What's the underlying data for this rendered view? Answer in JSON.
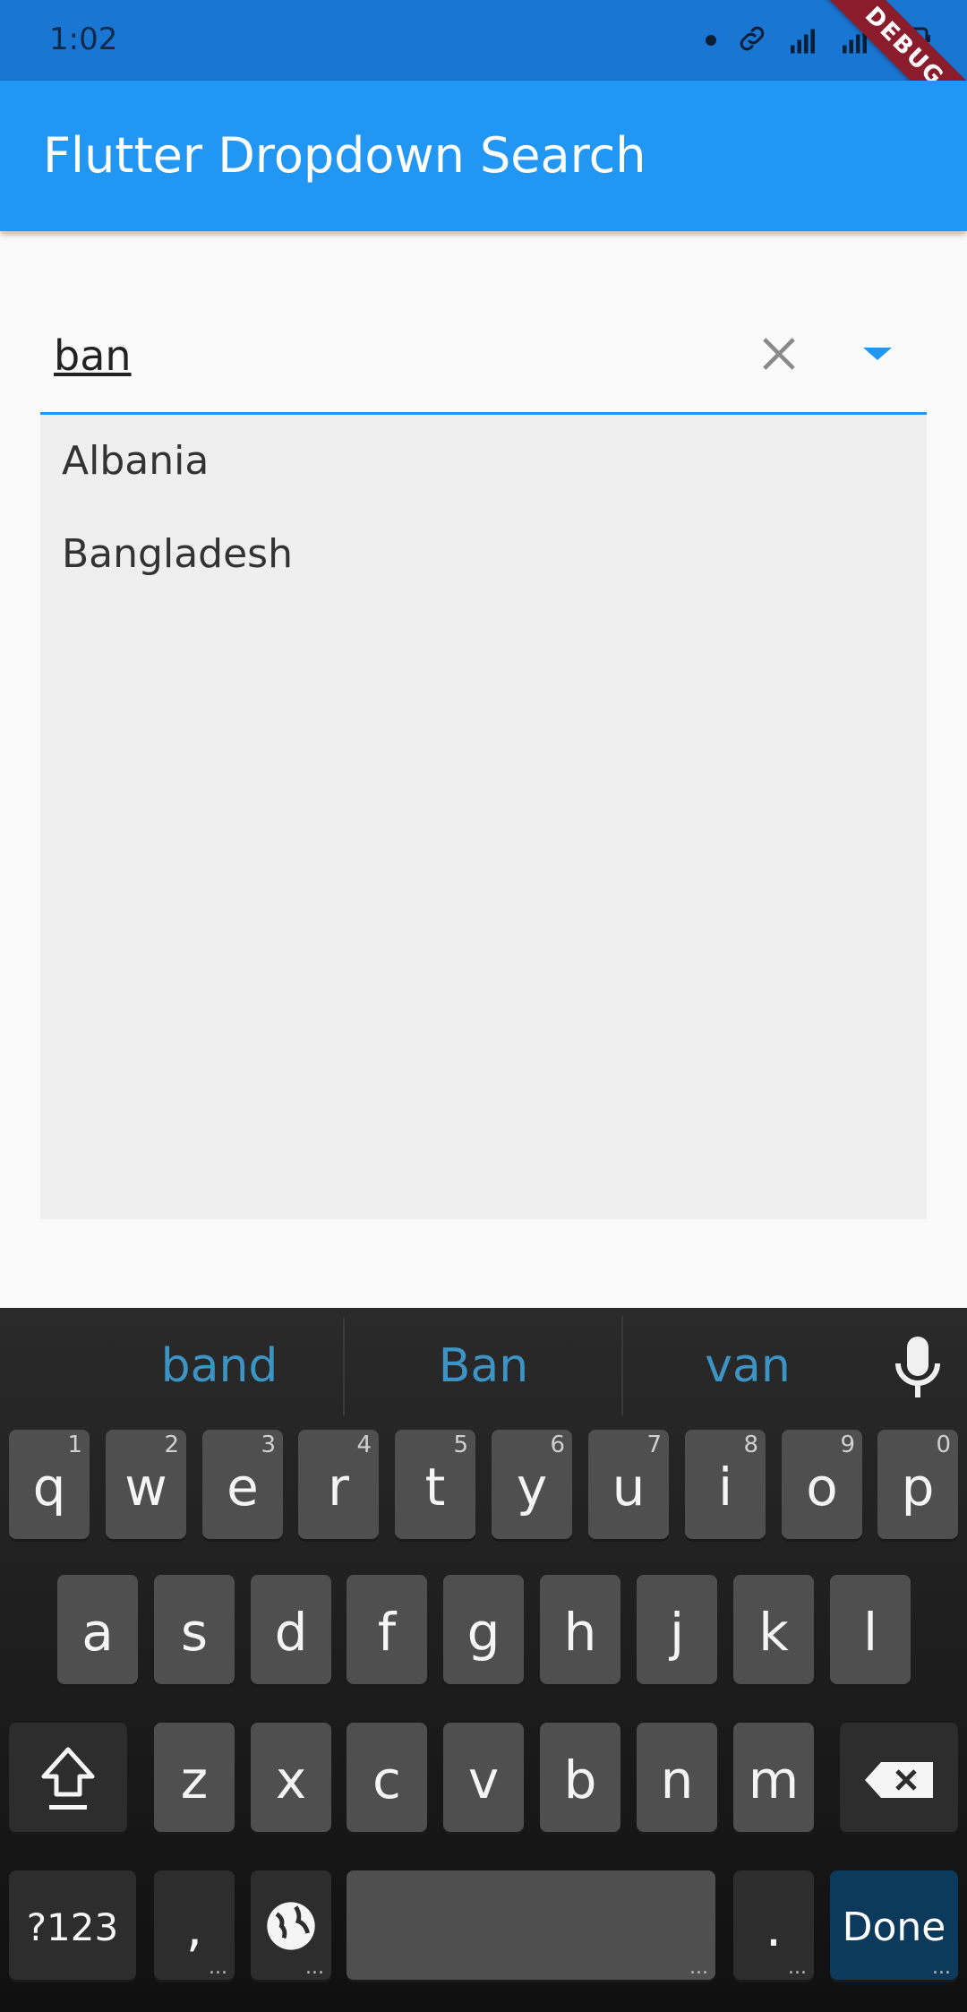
{
  "status_bar": {
    "time": "1:02",
    "debug_label": "DEBUG"
  },
  "app_bar": {
    "title": "Flutter Dropdown Search"
  },
  "search": {
    "value": "ban"
  },
  "results": [
    {
      "label": "Albania"
    },
    {
      "label": "Bangladesh"
    }
  ],
  "keyboard": {
    "suggestions": [
      "band",
      "Ban",
      "van"
    ],
    "row1": [
      {
        "letter": "q",
        "num": "1"
      },
      {
        "letter": "w",
        "num": "2"
      },
      {
        "letter": "e",
        "num": "3"
      },
      {
        "letter": "r",
        "num": "4"
      },
      {
        "letter": "t",
        "num": "5"
      },
      {
        "letter": "y",
        "num": "6"
      },
      {
        "letter": "u",
        "num": "7"
      },
      {
        "letter": "i",
        "num": "8"
      },
      {
        "letter": "o",
        "num": "9"
      },
      {
        "letter": "p",
        "num": "0"
      }
    ],
    "row2": [
      "a",
      "s",
      "d",
      "f",
      "g",
      "h",
      "j",
      "k",
      "l"
    ],
    "row3": [
      "z",
      "x",
      "c",
      "v",
      "b",
      "n",
      "m"
    ],
    "symbols_label": "?123",
    "comma_label": ",",
    "period_label": ".",
    "done_label": "Done",
    "more_dots": "..."
  },
  "colors": {
    "primary": "#2196f3",
    "status_bar": "#1976d2",
    "suggestion_text": "#3d93c4"
  }
}
